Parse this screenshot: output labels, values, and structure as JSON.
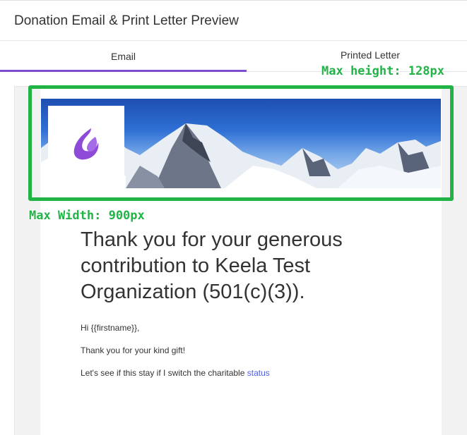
{
  "header": {
    "title": "Donation Email & Print Letter Preview"
  },
  "tabs": [
    {
      "label": "Email",
      "active": true
    },
    {
      "label": "Printed Letter",
      "active": false
    }
  ],
  "annotations": {
    "max_height": "Max height: 128px",
    "max_width": "Max Width: 900px"
  },
  "colors": {
    "accent": "#7c4dcc",
    "annotation_green": "#22b347",
    "link": "#4a5de0"
  },
  "email": {
    "banner_logo_icon": "keela-flame-logo-icon",
    "headline": "Thank you for your generous contribution to Keela Test Organization (501(c)(3)).",
    "greeting": "Hi {{firstname}},",
    "thanks": "Thank you for your kind gift!",
    "line3_text": "Let's see if this stay if I switch the charitable ",
    "line3_link": "status"
  }
}
